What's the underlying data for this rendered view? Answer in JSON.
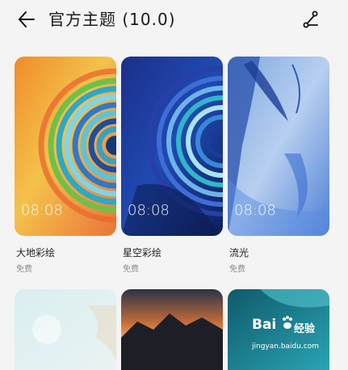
{
  "header": {
    "title": "官方主题 (10.0)",
    "back_icon": "back-arrow-icon",
    "share_icon": "share-icon"
  },
  "themes": [
    {
      "name": "大地彩绘",
      "price": "免费",
      "clock": "08:08"
    },
    {
      "name": "星空彩绘",
      "price": "免费",
      "clock": "08:08"
    },
    {
      "name": "流光",
      "price": "免费",
      "clock": "08:08"
    }
  ],
  "watermark": {
    "brand": "Bai",
    "brand_cn": "经验",
    "url": "jingyan.baidu.com"
  },
  "colors": {
    "background": "#f4f4f4",
    "card1_primary": "#f0a23c",
    "card2_primary": "#1b3f9e",
    "card3_primary": "#4a7bd0"
  }
}
